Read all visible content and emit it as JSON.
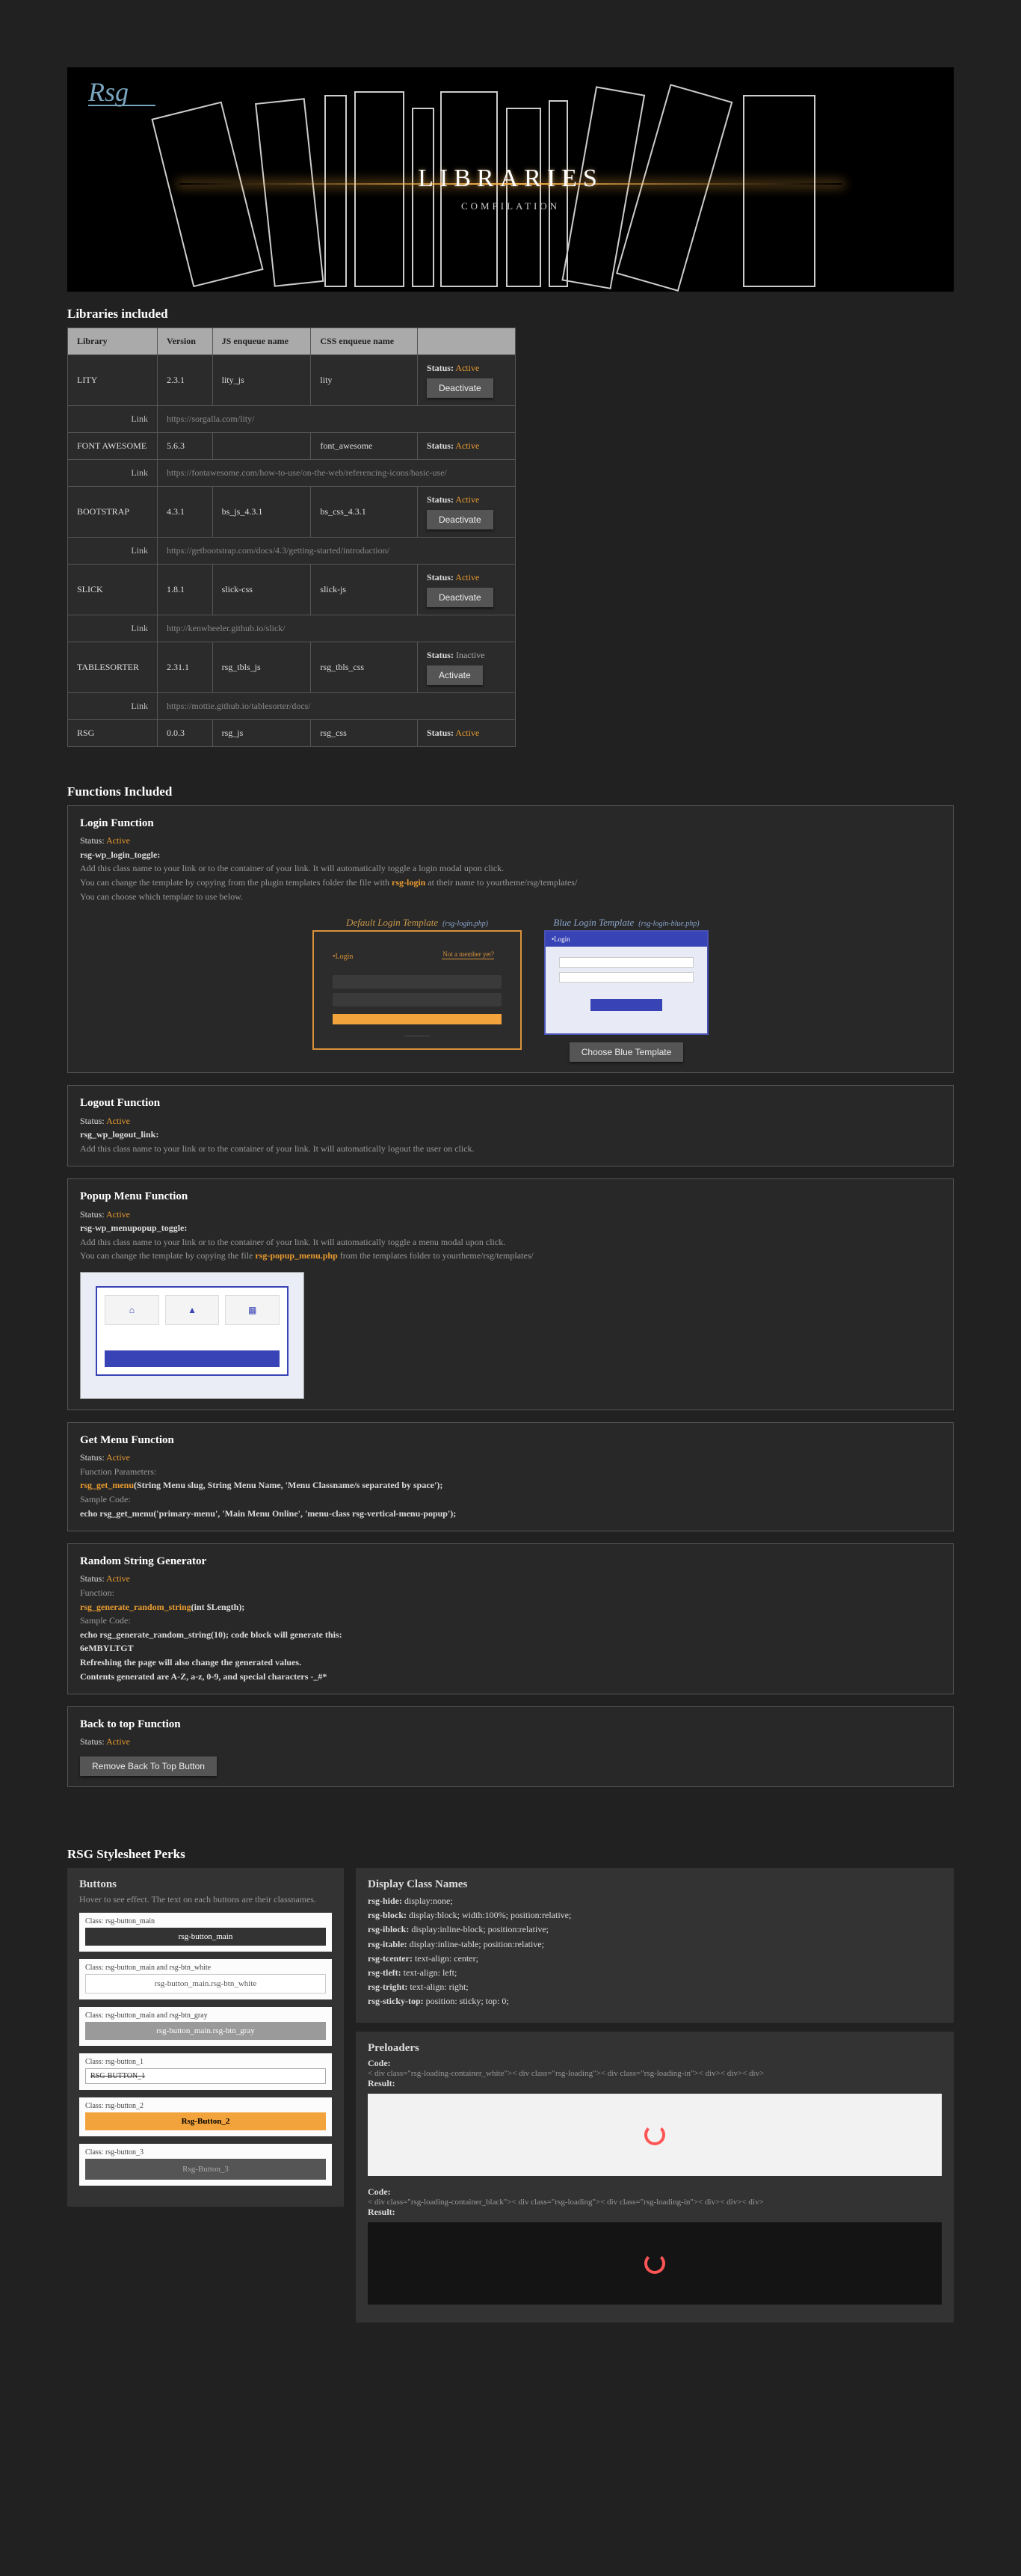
{
  "banner": {
    "title": "LIBRARIES",
    "sub": "COMPILATION",
    "logo": "Rsg"
  },
  "sections": {
    "libs_title": "Libraries included",
    "funcs_title": "Functions Included",
    "perks_title": "RSG Stylesheet Perks"
  },
  "table": {
    "headers": [
      "Library",
      "Version",
      "JS enqueue name",
      "CSS enqueue name",
      ""
    ],
    "rows": [
      {
        "lib": "LITY",
        "ver": "2.3.1",
        "js": "lity_js",
        "css": "lity",
        "status": "Active",
        "btn": "Deactivate",
        "link_label": "Link",
        "link": "https://sorgalla.com/lity/"
      },
      {
        "lib": "FONT AWESOME",
        "ver": "5.6.3",
        "js": "",
        "css": "font_awesome",
        "status": "Active",
        "btn": "",
        "link_label": "Link",
        "link": "https://fontawesome.com/how-to-use/on-the-web/referencing-icons/basic-use/"
      },
      {
        "lib": "BOOTSTRAP",
        "ver": "4.3.1",
        "js": "bs_js_4.3.1",
        "css": "bs_css_4.3.1",
        "status": "Active",
        "btn": "Deactivate",
        "link_label": "Link",
        "link": "https://getbootstrap.com/docs/4.3/getting-started/introduction/"
      },
      {
        "lib": "SLICK",
        "ver": "1.8.1",
        "js": "slick-css",
        "css": "slick-js",
        "status": "Active",
        "btn": "Deactivate",
        "link_label": "Link",
        "link": "http://kenwheeler.github.io/slick/"
      },
      {
        "lib": "TABLESORTER",
        "ver": "2.31.1",
        "js": "rsg_tbls_js",
        "css": "rsg_tbls_css",
        "status": "Inactive",
        "btn": "Activate",
        "link_label": "Link",
        "link": "https://mottie.github.io/tablesorter/docs/"
      },
      {
        "lib": "RSG",
        "ver": "0.0.3",
        "js": "rsg_js",
        "css": "rsg_css",
        "status": "Active",
        "btn": "",
        "link_label": "",
        "link": ""
      }
    ],
    "status_label": "Status:"
  },
  "login": {
    "title": "Login Function",
    "status": "Active",
    "class": "rsg-wp_login_toggle:",
    "desc1": "Add this class name to your link or to the container of your link. It will automatically toggle a login modal upon click.",
    "desc2a": "You can change the template by copying from the plugin templates folder the file with ",
    "desc2b": "rsg-login",
    "desc2c": " at their name to yourtheme/rsg/templates/",
    "desc3": "You can choose which template to use below.",
    "tpl_default": "Default Login Template",
    "tpl_default_f": "(rsg-login.php)",
    "tpl_blue": "Blue Login Template",
    "tpl_blue_f": "(rsg-login-blue.php)",
    "choose_btn": "Choose Blue Template",
    "mock_login": "•Login",
    "mock_notmember": "Not a member yet?"
  },
  "logout": {
    "title": "Logout Function",
    "status": "Active",
    "class": "rsg_wp_logout_link:",
    "desc": "Add this class name to your link or to the container of your link. It will automatically logout the user on click."
  },
  "popup": {
    "title": "Popup Menu Function",
    "status": "Active",
    "class": "rsg-wp_menupopup_toggle:",
    "desc1": "Add this class name to your link or to the container of your link. It will automatically toggle a menu modal upon click.",
    "desc2a": "You can change the template by copying the file ",
    "desc2b": "rsg-popup_menu.php",
    "desc2c": " from the templates folder to yourtheme/rsg/templates/"
  },
  "getmenu": {
    "title": "Get Menu Function",
    "status": "Active",
    "params_label": "Function Parameters:",
    "sig": "rsg_get_menu(String Menu slug, String Menu Name, 'Menu Classname/s separated by space');",
    "sig_fn": "rsg_get_menu",
    "sample_label": "Sample Code:",
    "sample": "echo rsg_get_menu('primary-menu', 'Main Menu Online', 'menu-class rsg-vertical-menu-popup');"
  },
  "random": {
    "title": "Random String Generator",
    "status": "Active",
    "func_label": "Function:",
    "sig": "rsg_generate_random_string(int $Length);",
    "sig_fn": "rsg_generate_random_string",
    "sample_label": "Sample Code:",
    "sample": "echo rsg_generate_random_string(10); code block will generate this:",
    "out": "6eMBYLTGT",
    "note1": "Refreshing the page will also change the generated values.",
    "note2": "Contents generated are A-Z, a-z, 0-9, and special characters -_#*"
  },
  "backtop": {
    "title": "Back to top Function",
    "status": "Active",
    "btn": "Remove Back To Top Button"
  },
  "perks": {
    "buttons": {
      "title": "Buttons",
      "hover": "Hover to see effect. The text on each buttons are their classnames.",
      "b1_cap": "Class: rsg-button_main",
      "b1": "rsg-button_main",
      "b2_cap": "Class: rsg-button_main and rsg-btn_white",
      "b2": "rsg-button_main.rsg-btn_white",
      "b3_cap": "Class: rsg-button_main and rsg-btn_gray",
      "b3": "rsg-button_main.rsg-btn_gray",
      "b4_cap": "Class: rsg-button_1",
      "b4": "RSG-BUTTON_1",
      "b5_cap": "Class: rsg-button_2",
      "b5": "Rsg-Button_2",
      "b6_cap": "Class: rsg-button_3",
      "b6": "Rsg-Button_3"
    },
    "display": {
      "title": "Display Class Names",
      "l1a": "rsg-hide:",
      "l1b": " display:none;",
      "l2a": "rsg-block:",
      "l2b": " display:block; width:100%; position:relative;",
      "l3a": "rsg-iblock:",
      "l3b": " display:inline-block; position:relative;",
      "l4a": "rsg-itable:",
      "l4b": " display:inline-table; position:relative;",
      "l5a": "rsg-tcenter:",
      "l5b": " text-align: center;",
      "l6a": "rsg-tleft:",
      "l6b": " text-align: left;",
      "l7a": "rsg-tright:",
      "l7b": " text-align: right;",
      "l8a": "rsg-sticky-top:",
      "l8b": " position: sticky; top: 0;"
    },
    "preloaders": {
      "title": "Preloaders",
      "code_label": "Code:",
      "result_label": "Result:",
      "code_white": "< div class=\"rsg-loading-container_white\">< div class=\"rsg-loading\">< div class=\"rsg-loading-in\">< div>< div>< div>",
      "code_black": "< div class=\"rsg-loading-container_black\">< div class=\"rsg-loading\">< div class=\"rsg-loading-in\">< div>< div>< div>"
    }
  }
}
